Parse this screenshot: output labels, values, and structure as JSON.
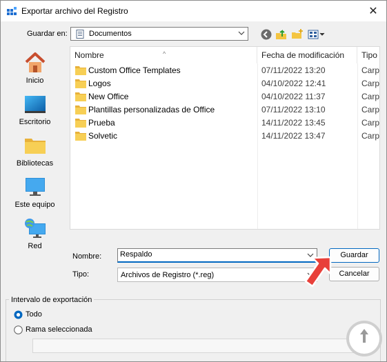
{
  "window": {
    "title": "Exportar archivo del Registro",
    "close_glyph": "✕",
    "icon": "registry-editor-icon"
  },
  "location": {
    "label": "Guardar en:",
    "value": "Documentos",
    "toolbar_icons": [
      "back-arrow-icon",
      "up-folder-icon",
      "new-folder-icon",
      "view-menu-icon"
    ]
  },
  "places": [
    {
      "label": "Inicio",
      "icon": "home-icon"
    },
    {
      "label": "Escritorio",
      "icon": "desktop-icon"
    },
    {
      "label": "Bibliotecas",
      "icon": "libraries-folder-icon"
    },
    {
      "label": "Este equipo",
      "icon": "computer-icon"
    },
    {
      "label": "Red",
      "icon": "network-icon"
    }
  ],
  "files": {
    "columns": [
      "Nombre",
      "Fecha de modificación",
      "Tipo"
    ],
    "rows": [
      {
        "name": "Custom Office Templates",
        "date": "07/11/2022 13:20",
        "type": "Carpe"
      },
      {
        "name": "Logos",
        "date": "04/10/2022 12:41",
        "type": "Carpe"
      },
      {
        "name": "New Office",
        "date": "04/10/2022 11:37",
        "type": "Carpe"
      },
      {
        "name": "Plantillas personalizadas de Office",
        "date": "07/11/2022 13:10",
        "type": "Carpe"
      },
      {
        "name": "Prueba",
        "date": "14/11/2022 13:45",
        "type": "Carpe"
      },
      {
        "name": "Solvetic",
        "date": "14/11/2022 13:47",
        "type": "Carpe"
      }
    ]
  },
  "form": {
    "name_label": "Nombre:",
    "name_value": "Respaldo",
    "type_label": "Tipo:",
    "type_value": "Archivos de Registro (*.reg)",
    "save_button": "Guardar",
    "cancel_button": "Cancelar"
  },
  "export_range": {
    "legend": "Intervalo de exportación",
    "option_all": "Todo",
    "option_branch": "Rama seleccionada",
    "selected": "Todo",
    "branch_value": ""
  },
  "colors": {
    "accent": "#0067c0",
    "folder": "#f4c542",
    "arrow": "#e8403a"
  }
}
